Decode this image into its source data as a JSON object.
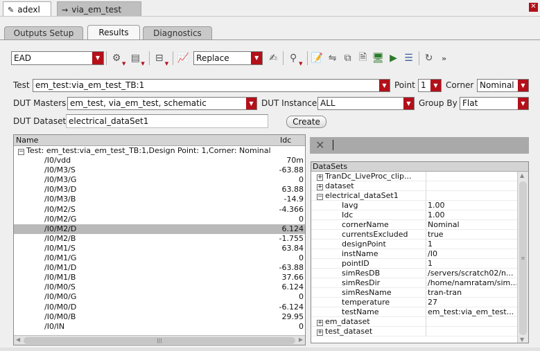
{
  "doc_tabs": [
    {
      "label": "adexl",
      "active": true,
      "icon": "pencil-icon"
    },
    {
      "label": "via_em_test",
      "active": false,
      "icon": "schematic-icon"
    }
  ],
  "inner_tabs": [
    "Outputs Setup",
    "Results",
    "Diagnostics"
  ],
  "toolbar": {
    "view_combo": "EAD",
    "mode_combo": "Replace"
  },
  "form": {
    "test_label": "Test",
    "test_value": "em_test:via_em_test_TB:1",
    "point_label": "Point",
    "point_value": "1",
    "corner_label": "Corner",
    "corner_value": "Nominal",
    "dut_masters_label": "DUT Masters",
    "dut_masters_value": "em_test, via_em_test, schematic",
    "dut_instance_label": "DUT Instance",
    "dut_instance_value": "ALL",
    "group_by_label": "Group By",
    "group_by_value": "Flat",
    "dut_dataset_label": "DUT Dataset",
    "dut_dataset_value": "electrical_dataSet1",
    "create_label": "Create"
  },
  "left_table": {
    "col_name": "Name",
    "col_idc": "Idc",
    "group": "Test: em_test:via_em_test_TB:1,Design Point: 1,Corner: Nominal",
    "rows": [
      {
        "name": "/I0/vdd",
        "idc": "70m"
      },
      {
        "name": "/I0/M3/S",
        "idc": "-63.88"
      },
      {
        "name": "/I0/M3/G",
        "idc": "0"
      },
      {
        "name": "/I0/M3/D",
        "idc": "63.88"
      },
      {
        "name": "/I0/M3/B",
        "idc": "-14.9"
      },
      {
        "name": "/I0/M2/S",
        "idc": "-4.366"
      },
      {
        "name": "/I0/M2/G",
        "idc": "0"
      },
      {
        "name": "/I0/M2/D",
        "idc": "6.124"
      },
      {
        "name": "/I0/M2/B",
        "idc": "-1.755"
      },
      {
        "name": "/I0/M1/S",
        "idc": "63.84"
      },
      {
        "name": "/I0/M1/G",
        "idc": "0"
      },
      {
        "name": "/I0/M1/D",
        "idc": "-63.88"
      },
      {
        "name": "/I0/M1/B",
        "idc": "37.66"
      },
      {
        "name": "/I0/M0/S",
        "idc": "6.124"
      },
      {
        "name": "/I0/M0/G",
        "idc": "0"
      },
      {
        "name": "/I0/M0/D",
        "idc": "-6.124"
      },
      {
        "name": "/I0/M0/B",
        "idc": "29.95"
      },
      {
        "name": "/I0/IN",
        "idc": "0"
      }
    ],
    "selected_row": "/I0/M2/D"
  },
  "datasets": {
    "header": "DataSets",
    "rows": [
      {
        "key": "TranDc_LiveProc_clip...",
        "value": "",
        "level": 0,
        "toggle": "+"
      },
      {
        "key": "dataset",
        "value": "",
        "level": 0,
        "toggle": "+"
      },
      {
        "key": "electrical_dataSet1",
        "value": "",
        "level": 0,
        "toggle": "-"
      },
      {
        "key": "Iavg",
        "value": "1.00",
        "level": 1,
        "toggle": ""
      },
      {
        "key": "Idc",
        "value": "1.00",
        "level": 1,
        "toggle": ""
      },
      {
        "key": "cornerName",
        "value": "Nominal",
        "level": 1,
        "toggle": ""
      },
      {
        "key": "currentsExcluded",
        "value": "true",
        "level": 1,
        "toggle": ""
      },
      {
        "key": "designPoint",
        "value": "1",
        "level": 1,
        "toggle": ""
      },
      {
        "key": "instName",
        "value": "/I0",
        "level": 1,
        "toggle": ""
      },
      {
        "key": "pointID",
        "value": "1",
        "level": 1,
        "toggle": ""
      },
      {
        "key": "simResDB",
        "value": "/servers/scratch02/n...",
        "level": 1,
        "toggle": ""
      },
      {
        "key": "simResDir",
        "value": "/home/namratam/sim...",
        "level": 1,
        "toggle": ""
      },
      {
        "key": "simResName",
        "value": "tran-tran",
        "level": 1,
        "toggle": ""
      },
      {
        "key": "temperature",
        "value": "27",
        "level": 1,
        "toggle": ""
      },
      {
        "key": "testName",
        "value": "em_test:via_em_test...",
        "level": 1,
        "toggle": ""
      },
      {
        "key": "em_dataset",
        "value": "",
        "level": 0,
        "toggle": "+"
      },
      {
        "key": "test_dataset",
        "value": "",
        "level": 0,
        "toggle": "+"
      }
    ]
  },
  "colors": {
    "accent_red": "#b3101a",
    "selection_gray": "#b9b9b9"
  }
}
